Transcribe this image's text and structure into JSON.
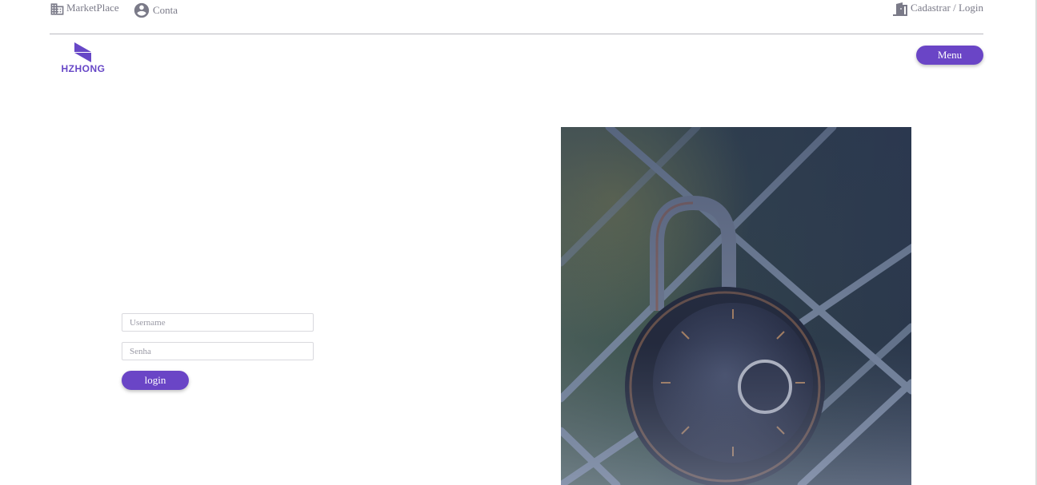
{
  "topbar": {
    "marketplace_label": "MarketPlace",
    "conta_label": "Conta",
    "cadastrar_login_label": "Cadastrar / Login"
  },
  "header": {
    "logo_text": "HZHONG",
    "menu_label": "Menu"
  },
  "login_form": {
    "username_placeholder": "Username",
    "password_placeholder": "Senha",
    "login_label": "login"
  },
  "colors": {
    "accent": "#6a45c6",
    "icon_gray": "#7a7a88"
  },
  "icons": {
    "marketplace": "building-icon",
    "conta": "account-circle-icon",
    "cadastrar": "door-icon"
  }
}
